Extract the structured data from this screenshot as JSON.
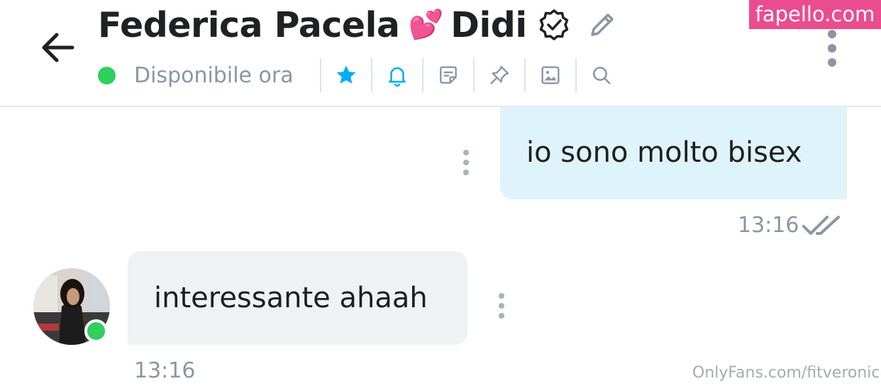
{
  "header": {
    "title_name": "Federica Pacela",
    "title_emoji": "💕",
    "title_nick": "Didi",
    "status": "Disponibile ora",
    "toolbar_icons": [
      "star-icon",
      "bell-icon",
      "note-icon",
      "pin-icon",
      "image-icon",
      "search-icon"
    ],
    "colors": {
      "online": "#2fcf5e",
      "accent": "#00aff0",
      "muted": "#8a96a3"
    }
  },
  "brand_badge": "fapello.com",
  "messages": [
    {
      "direction": "outgoing",
      "text": "io sono molto bisex",
      "time": "13:16",
      "read": true,
      "bubble_color": "#dff3fb"
    },
    {
      "direction": "incoming",
      "text": "interessante ahaah",
      "time": "13:16",
      "bubble_color": "#eff1f2"
    }
  ],
  "watermark": "OnlyFans.com/fitveronica"
}
